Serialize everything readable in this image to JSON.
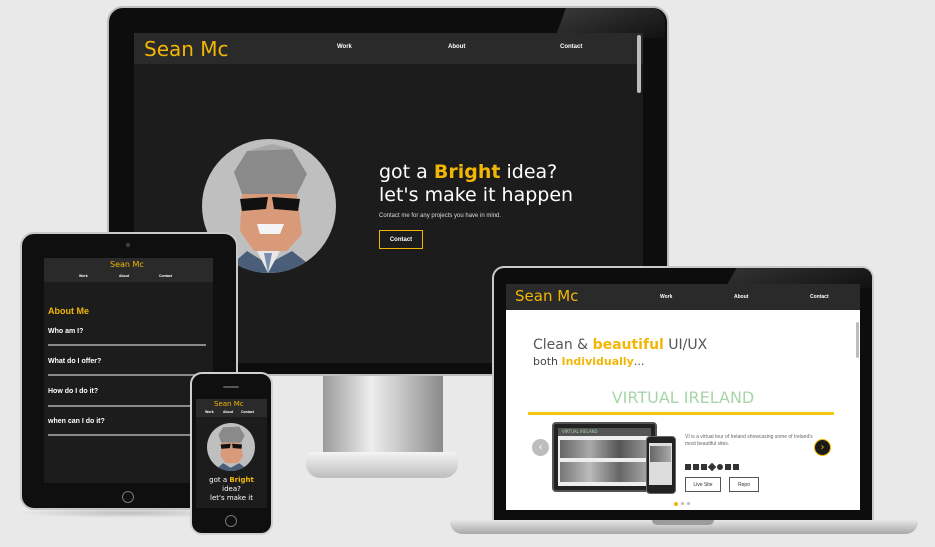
{
  "brand": {
    "name": "Sean Mc",
    "accent": "#f2b705"
  },
  "nav": {
    "work": "Work",
    "about": "About",
    "contact": "Contact"
  },
  "hero": {
    "line1_pre": "got a ",
    "line1_highlight": "Bright",
    "line1_post": " idea?",
    "line2": "let's make it happen",
    "sub": "Contact me for any projects you have in mind.",
    "button": "Contact"
  },
  "tablet": {
    "section_title": "About Me",
    "questions": [
      "Who am I?",
      "What do I offer?",
      "How do I do it?",
      "when can I do it?"
    ]
  },
  "phone": {
    "line1_pre": "got a ",
    "line1_highlight": "Bright",
    "line2": "idea?",
    "line3": "let's make it"
  },
  "laptop": {
    "headline_pre": "Clean & ",
    "headline_highlight": "beautiful",
    "headline_post": " UI/UX",
    "sub_pre": "both ",
    "sub_highlight": "Individually",
    "sub_post": "...",
    "project_title": "VIRTUAL IRELAND",
    "project_desc": "VI is a virtual tour of Ireland showcasing some of Ireland's most beautiful sites.",
    "live_button": "Live Site",
    "repo_button": "Repo",
    "mini_brand": "VIRTUAL IRELAND"
  },
  "colors": {
    "dark": "#1c1c1c",
    "nav": "#2a2a2a",
    "project_title": "#a8d5a8",
    "underline": "#f2c80f"
  }
}
